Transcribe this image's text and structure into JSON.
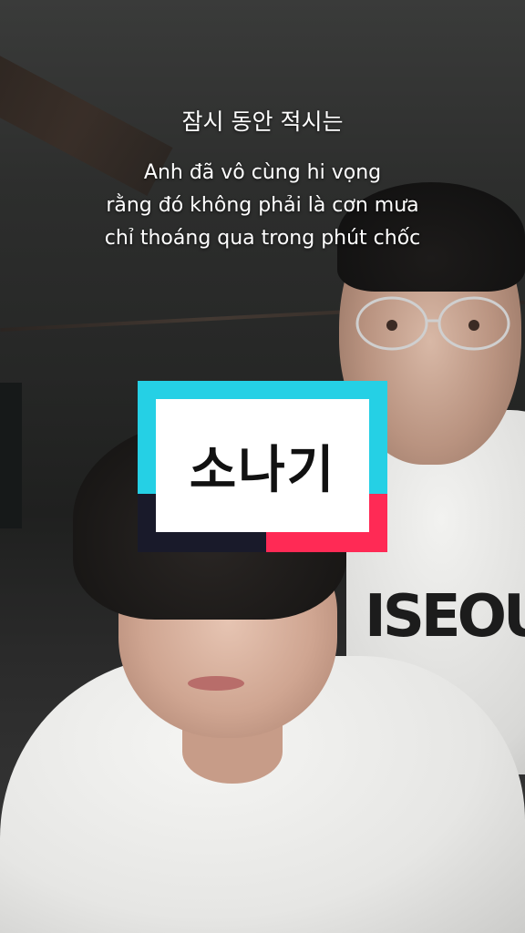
{
  "video": {
    "lyric_korean": "잠시 동안 적시는",
    "lyric_vietnamese": [
      "Anh đã vô cùng hi vọng",
      "rằng đó không phải là cơn mưa",
      "chỉ thoáng qua trong phút chốc"
    ],
    "song_title": "소나기",
    "shirt_print": "ISEOU"
  },
  "colors": {
    "logo_cyan": "#25d0e5",
    "logo_red": "#ff2a55",
    "logo_navy": "#191a2a",
    "subtitle_text": "#ffffff"
  }
}
